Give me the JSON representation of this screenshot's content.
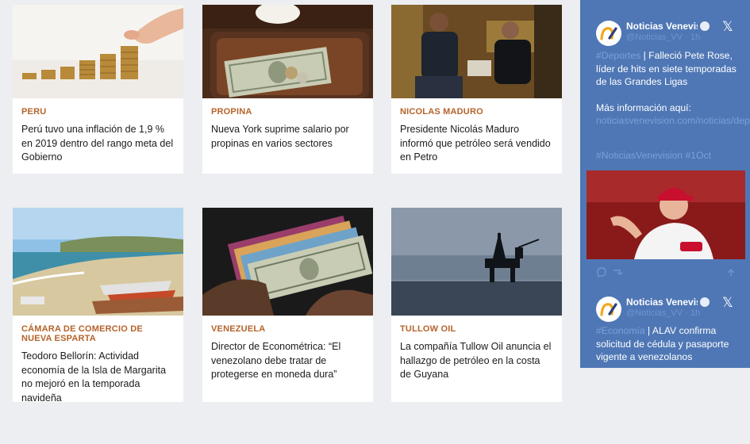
{
  "cards": [
    {
      "category": "PERU",
      "title": "Perú tuvo una inflación de 1,9 % en 2019 dentro del rango meta del Gobierno"
    },
    {
      "category": "PROPINA",
      "title": "Nueva York suprime salario por propinas en varios sectores"
    },
    {
      "category": "NICOLAS MADURO",
      "title": "Presidente Nicolás Maduro informó que petróleo será vendido en Petro"
    },
    {
      "category": "CÁMARA DE COMERCIO DE NUEVA ESPARTA",
      "title": "Teodoro Bellorín: Actividad economía de la Isla de Margarita no mejoró en la temporada navideña"
    },
    {
      "category": "VENEZUELA",
      "title": "Director de Econométrica: “El venezolano debe tratar de protegerse en moneda dura”"
    },
    {
      "category": "TULLOW OIL",
      "title": "La compañía Tullow Oil anuncia el hallazgo de petróleo en la costa de Guyana"
    }
  ],
  "twitter": {
    "accent": "#4f77b5",
    "tweets": [
      {
        "name": "Noticias Venevisi",
        "handle": "@Noticias_VV · 1h",
        "hashtag": "#Deportes",
        "text": " | Falleció Pete Rose, líder de hits en siete temporadas de las Grandes Ligas",
        "more": "Más información aquí:",
        "link": "noticiasvenevision.com/noticias/depor…",
        "tags": "#NoticiasVenevision #1Oct"
      },
      {
        "name": "Noticias Venevisi",
        "handle": "@Noticias_VV · 1h",
        "hashtag": "#Economía",
        "text": " | ALAV confirma solicitud de cédula y pasaporte vigente a venezolanos"
      }
    ],
    "x_icon": "x-logo-icon"
  }
}
